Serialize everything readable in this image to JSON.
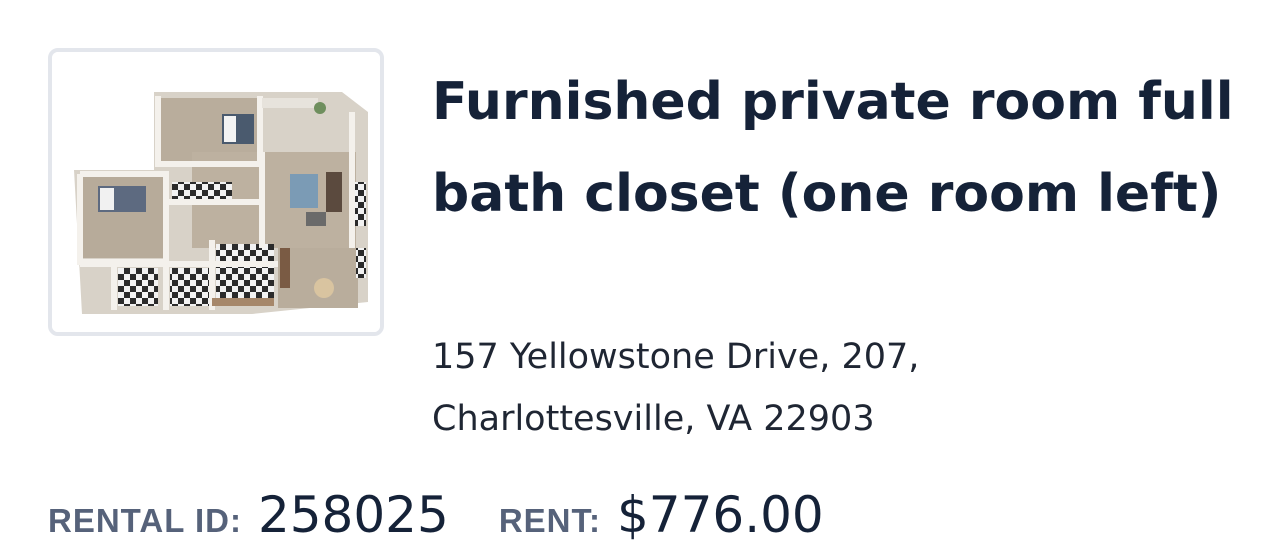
{
  "listing": {
    "title": "Furnished private room full bath closet (one room left)",
    "address_line1": "157 Yellowstone Drive, 207,",
    "address_line2": "Charlottesville, VA 22903",
    "rental_id_label": "RENTAL ID:",
    "rental_id_value": "258025",
    "rent_label": "RENT:",
    "rent_value": "$776.00",
    "thumbnail_icon": "floor-plan-image"
  },
  "colors": {
    "title": "#152238",
    "label": "#56627a",
    "card_border": "#e3e6ec"
  }
}
